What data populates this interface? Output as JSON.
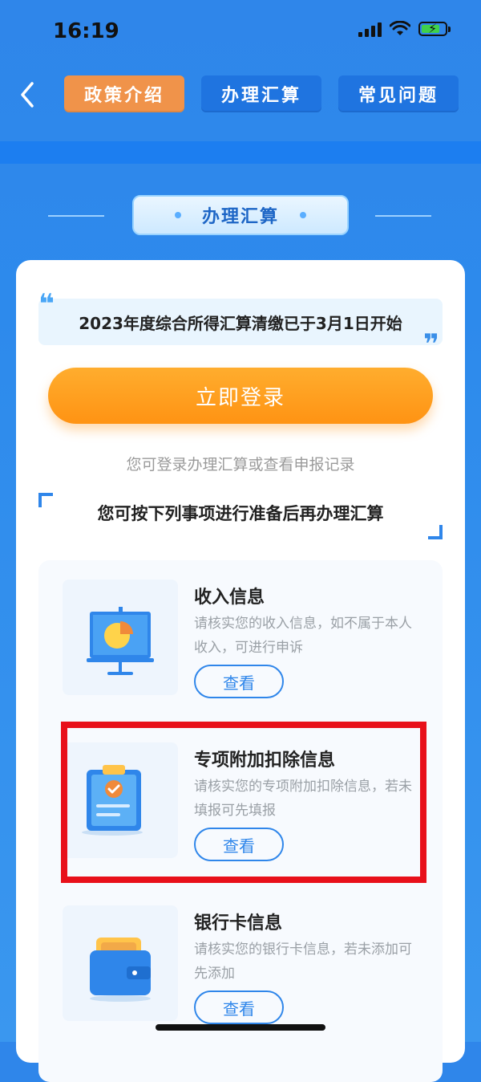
{
  "status_bar": {
    "time": "16:19"
  },
  "header": {
    "tabs": [
      {
        "label": "政策介绍",
        "active": true
      },
      {
        "label": "办理汇算",
        "active": false
      },
      {
        "label": "常见问题",
        "active": false
      }
    ]
  },
  "section": {
    "title": "办理汇算"
  },
  "notice": {
    "text": "2023年度综合所得汇算清缴已于3月1日开始"
  },
  "login": {
    "button_label": "立即登录",
    "hint": "您可登录办理汇算或查看申报记录"
  },
  "prep": {
    "title": "您可按下列事项进行准备后再办理汇算"
  },
  "items": [
    {
      "title": "收入信息",
      "desc": "请核实您的收入信息，如不属于本人收入，可进行申诉",
      "button_label": "查看",
      "icon": "presentation-chart-icon"
    },
    {
      "title": "专项附加扣除信息",
      "desc": "请核实您的专项附加扣除信息，若未填报可先填报",
      "button_label": "查看",
      "icon": "clipboard-check-icon"
    },
    {
      "title": "银行卡信息",
      "desc": "请核实您的银行卡信息，若未添加可先添加",
      "button_label": "查看",
      "icon": "wallet-icon"
    }
  ],
  "colors": {
    "primary": "#2f86ea",
    "accent_orange": "#ff9f1f",
    "tab_active": "#f0934a",
    "highlight_red": "#e8101a"
  }
}
